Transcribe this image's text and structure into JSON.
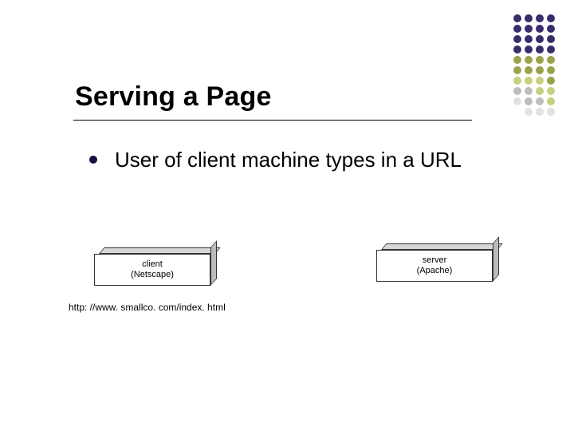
{
  "title": "Serving a Page",
  "bullet": "User of client machine types in a URL",
  "client": {
    "line1": "client",
    "line2": "(Netscape)"
  },
  "server": {
    "line1": "server",
    "line2": "(Apache)"
  },
  "url": "http: //www. smallco. com/index. html",
  "dot_colors": {
    "dark": "#3a2b6b",
    "olive": "#9aa24a",
    "lolive": "#c8cf7d",
    "grey": "#bdbdbd",
    "lgrey": "#e2e2e2"
  },
  "dot_pattern": [
    [
      "dark",
      "dark",
      "dark",
      "dark"
    ],
    [
      "dark",
      "dark",
      "dark",
      "dark"
    ],
    [
      "dark",
      "dark",
      "dark",
      "dark"
    ],
    [
      "dark",
      "dark",
      "dark",
      "dark"
    ],
    [
      "olive",
      "olive",
      "olive",
      "olive"
    ],
    [
      "olive",
      "olive",
      "olive",
      "olive"
    ],
    [
      "lolive",
      "lolive",
      "lolive",
      "olive"
    ],
    [
      "grey",
      "grey",
      "lolive",
      "lolive"
    ],
    [
      "lgrey",
      "grey",
      "grey",
      "lolive"
    ],
    [
      "lgrey",
      "lgrey",
      "lgrey"
    ]
  ]
}
